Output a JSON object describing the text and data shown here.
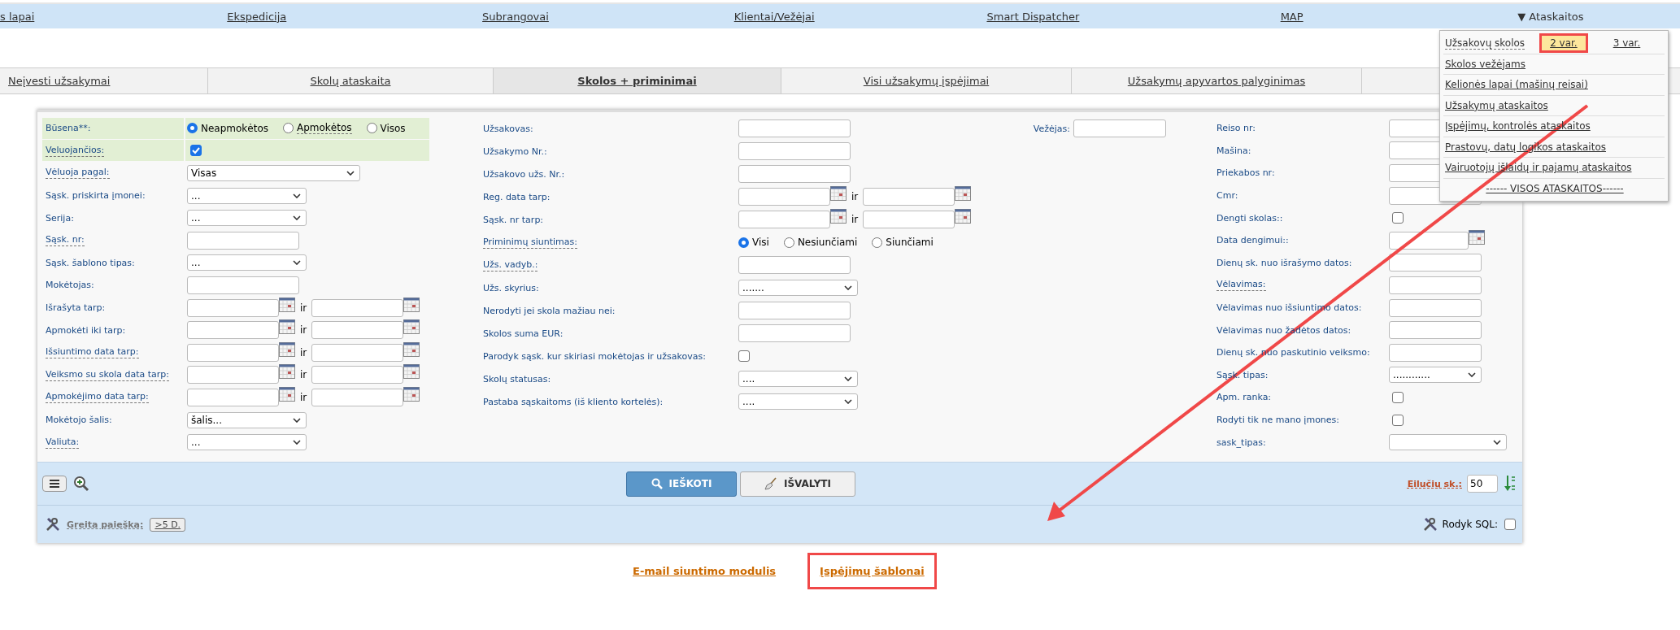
{
  "top_nav": [
    {
      "label": "s lapai",
      "kind": "link"
    },
    {
      "label": "Ekspedicija",
      "kind": "link"
    },
    {
      "label": "Subrangovai",
      "kind": "link"
    },
    {
      "label": "Klientai/Vežėjai",
      "kind": "link"
    },
    {
      "label": "Smart Dispatcher",
      "kind": "link"
    },
    {
      "label": "MAP",
      "kind": "link"
    },
    {
      "label": "▼ Ataskaitos",
      "kind": "menu"
    }
  ],
  "tabs": [
    {
      "label": "Neįvesti užsakymai",
      "selected": false
    },
    {
      "label": "Skolų ataskaita",
      "selected": false
    },
    {
      "label": "Skolos + priminimai",
      "selected": true
    },
    {
      "label": "Visi užsakymų įspėjimai",
      "selected": false
    },
    {
      "label": "Užsakymų apyvartos palyginimas",
      "selected": false
    }
  ],
  "reports_menu": [
    {
      "label": "Užsakovų skolos",
      "variants": [
        {
          "label": "2 var.",
          "highlighted": true
        },
        {
          "label": "3 var.",
          "highlighted": false
        }
      ]
    },
    {
      "label": "Skolos vežėjams"
    },
    {
      "label": "Kelionės lapai (mašinų reisai)"
    },
    {
      "label": "Užsakymų ataskaitos"
    },
    {
      "label": "Įspėjimų, kontrolės ataskaitos"
    },
    {
      "label": "Prastovų, datų logikos ataskaitos"
    },
    {
      "label": "Vairuotojų išlaidų ir pajamų ataskaitos"
    },
    {
      "label": "------ VISOS ATASKAITOS------"
    }
  ],
  "form": {
    "columns": [
      {
        "fields": [
          {
            "label": "Būsena**:",
            "kind": "radio",
            "hint": false,
            "shaded": true,
            "options": [
              {
                "label": "Neapmokėtos",
                "selected": true,
                "hint": false
              },
              {
                "label": "Apmokėtos",
                "selected": false,
                "hint": true
              },
              {
                "label": "Visos",
                "selected": false,
                "hint": false
              }
            ]
          },
          {
            "label": "Veluojančios:",
            "kind": "checkbox",
            "hint": true,
            "shaded": true,
            "checked": true
          },
          {
            "label": "Vėluoja pagal:",
            "kind": "select",
            "hint": true,
            "shaded": false,
            "value": "Visas",
            "wide": true
          },
          {
            "label": "Sąsk. priskirta įmonei:",
            "kind": "select",
            "hint": false,
            "shaded": false,
            "value": "...",
            "wide": false
          },
          {
            "label": "Serija:",
            "kind": "select",
            "hint": false,
            "shaded": false,
            "value": "...",
            "wide": false
          },
          {
            "label": "Sąsk. nr:",
            "kind": "text",
            "hint": true,
            "shaded": false
          },
          {
            "label": "Sąsk. šablono tipas:",
            "kind": "select",
            "hint": false,
            "shaded": false,
            "value": "...",
            "wide": false
          },
          {
            "label": "Mokėtojas:",
            "kind": "text",
            "hint": false,
            "shaded": false
          },
          {
            "label": "Išrašyta tarp:",
            "kind": "date_range",
            "hint": false,
            "shaded": false,
            "connector": "ir"
          },
          {
            "label": "Apmokėti iki tarp:",
            "kind": "date_range",
            "hint": false,
            "shaded": false,
            "connector": "ir"
          },
          {
            "label": "Išsiuntimo data tarp:",
            "kind": "date_range",
            "hint": true,
            "shaded": false,
            "connector": "ir"
          },
          {
            "label": "Veiksmo su skola data tarp:",
            "kind": "date_range",
            "hint": true,
            "shaded": false,
            "connector": "ir"
          },
          {
            "label": "Apmokėjimo data tarp:",
            "kind": "date_range",
            "hint": true,
            "shaded": false,
            "connector": "ir"
          },
          {
            "label": "Mokėtojo šalis:",
            "kind": "select",
            "hint": false,
            "shaded": false,
            "value": "šalis...",
            "wide": false
          },
          {
            "label": "Valiuta:",
            "kind": "select",
            "hint": true,
            "shaded": false,
            "value": "...",
            "wide": false
          }
        ]
      },
      {
        "fields": [
          {
            "label": "Užsakovas:",
            "kind": "text",
            "hint": false,
            "shaded": false
          },
          {
            "label": "Užsakymo Nr.:",
            "kind": "text",
            "hint": false,
            "shaded": false
          },
          {
            "label": "Užsakovo užs. Nr.:",
            "kind": "text",
            "hint": false,
            "shaded": false
          },
          {
            "label": "Reg. data tarp:",
            "kind": "date_range",
            "hint": false,
            "shaded": false,
            "connector": "ir"
          },
          {
            "label": "Sąsk. nr tarp:",
            "kind": "date_range",
            "hint": false,
            "shaded": false,
            "connector": "ir"
          },
          {
            "label": "Priminimų siuntimas:",
            "kind": "radio",
            "hint": true,
            "shaded": false,
            "options": [
              {
                "label": "Visi",
                "selected": true,
                "hint": false
              },
              {
                "label": "Nesiunčiami",
                "selected": false,
                "hint": false
              },
              {
                "label": "Siunčiami",
                "selected": false,
                "hint": false
              }
            ]
          },
          {
            "label": "Užs. vadyb.:",
            "kind": "text",
            "hint": true,
            "shaded": false
          },
          {
            "label": "Užs. skyrius:",
            "kind": "select",
            "hint": false,
            "shaded": false,
            "value": ".......",
            "wide": false
          },
          {
            "label": "Nerodyti jei skola mažiau nei:",
            "kind": "text",
            "hint": false,
            "shaded": false
          },
          {
            "label": "Skolos suma EUR:",
            "kind": "text",
            "hint": false,
            "shaded": false
          },
          {
            "label": "Parodyk sąsk. kur skiriasi mokėtojas ir užsakovas:",
            "kind": "checkbox",
            "hint": false,
            "shaded": false,
            "checked": false
          },
          {
            "label": "Skolų statusas:",
            "kind": "select",
            "hint": false,
            "shaded": false,
            "value": "....",
            "wide": false
          },
          {
            "label": "Pastaba sąskaitoms (iš kliento kortelės):",
            "kind": "select",
            "hint": false,
            "shaded": false,
            "value": "....",
            "wide": false
          }
        ]
      },
      {
        "fields": [
          {
            "label": "Vežėjas:",
            "kind": "text",
            "hint": false,
            "shaded": false
          }
        ]
      },
      {
        "fields": [
          {
            "label": "Reiso nr:",
            "kind": "text",
            "hint": false,
            "shaded": false
          },
          {
            "label": "Mašina:",
            "kind": "text",
            "hint": false,
            "shaded": false
          },
          {
            "label": "Priekabos nr:",
            "kind": "text",
            "hint": false,
            "shaded": false
          },
          {
            "label": "Cmr:",
            "kind": "text",
            "hint": false,
            "shaded": false
          },
          {
            "label": "Dengti skolas::",
            "kind": "checkbox",
            "hint": false,
            "shaded": false,
            "checked": false
          },
          {
            "label": "Data dengimui::",
            "kind": "date",
            "hint": false,
            "shaded": false
          },
          {
            "label": "Dienų sk. nuo išrašymo datos:",
            "kind": "text",
            "hint": false,
            "shaded": false
          },
          {
            "label": "Vėlavimas:",
            "kind": "text",
            "hint": true,
            "shaded": false
          },
          {
            "label": "Vėlavimas nuo išsiuntimo datos:",
            "kind": "text",
            "hint": false,
            "shaded": false
          },
          {
            "label": "Vėlavimas nuo žadėtos datos:",
            "kind": "text",
            "hint": false,
            "shaded": false
          },
          {
            "label": "Dienų sk. nuo paskutinio veiksmo:",
            "kind": "text",
            "hint": false,
            "shaded": false
          },
          {
            "label": "Sąsk. tipas:",
            "kind": "select",
            "hint": false,
            "shaded": false,
            "value": "............",
            "wide": false
          },
          {
            "label": "Apm. ranka:",
            "kind": "checkbox",
            "hint": false,
            "shaded": false,
            "checked": false
          },
          {
            "label": "Rodyti tik ne mano įmones:",
            "kind": "checkbox",
            "hint": false,
            "shaded": false,
            "checked": false
          },
          {
            "label": "sask_tipas:",
            "kind": "select",
            "hint": false,
            "shaded": false,
            "wide": true
          }
        ]
      }
    ]
  },
  "footer": {
    "search_button": "IEŠKOTI",
    "clear_button": "IŠVALYTI",
    "rows_label": "Eilučių sk.:",
    "rows_value": "50",
    "quick_search_label": "Greita paieška:",
    "quick_search_chip": ">5 D.",
    "sql_label": "Rodyk SQL:",
    "sql_checked": false
  },
  "bottom_links": [
    {
      "label": "E-mail siuntimo modulis",
      "highlighted": false
    },
    {
      "label": "Įspėjimų šablonai",
      "highlighted": true
    }
  ],
  "annotation_arrow": true
}
